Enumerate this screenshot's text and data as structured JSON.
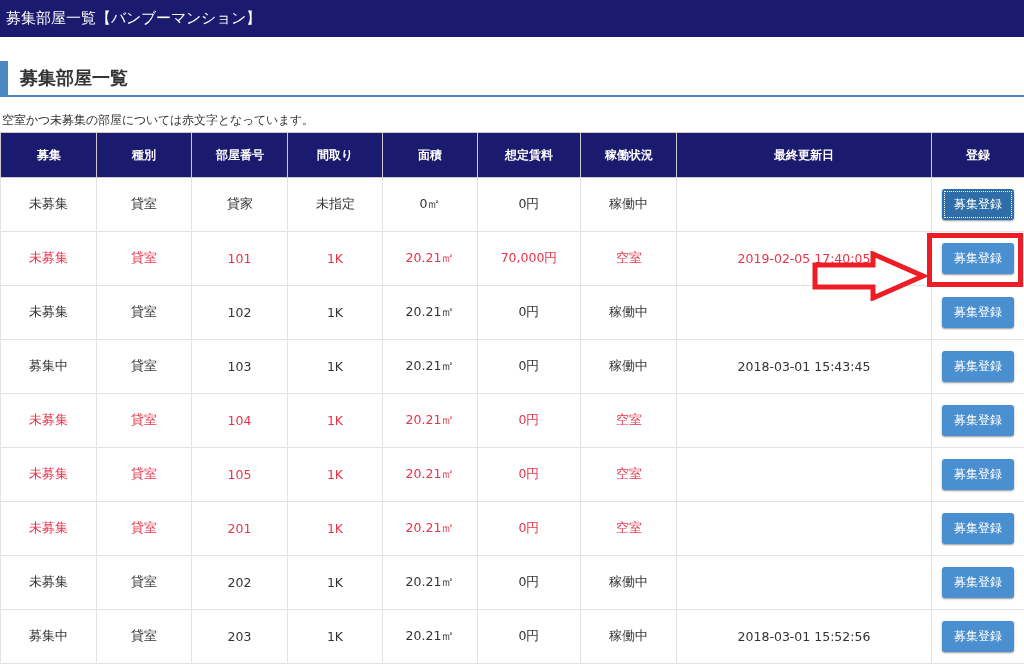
{
  "header": {
    "title": "募集部屋一覧【バンブーマンション】"
  },
  "section": {
    "heading": "募集部屋一覧",
    "note": "空室かつ未募集の部屋については赤文字となっています。"
  },
  "table": {
    "columns": [
      "募集",
      "種別",
      "部屋番号",
      "間取り",
      "面積",
      "想定賃料",
      "稼働状況",
      "最終更新日",
      "登録"
    ],
    "rows": [
      {
        "highlighted": false,
        "cells": [
          "未募集",
          "貸室",
          "貸家",
          "未指定",
          "0㎡",
          "0円",
          "稼働中",
          ""
        ],
        "button": "募集登録",
        "focused": true,
        "annotated": false
      },
      {
        "highlighted": true,
        "cells": [
          "未募集",
          "貸室",
          "101",
          "1K",
          "20.21㎡",
          "70,000円",
          "空室",
          "2019-02-05 17:40:05"
        ],
        "button": "募集登録",
        "focused": false,
        "annotated": true
      },
      {
        "highlighted": false,
        "cells": [
          "未募集",
          "貸室",
          "102",
          "1K",
          "20.21㎡",
          "0円",
          "稼働中",
          ""
        ],
        "button": "募集登録",
        "focused": false,
        "annotated": false
      },
      {
        "highlighted": false,
        "cells": [
          "募集中",
          "貸室",
          "103",
          "1K",
          "20.21㎡",
          "0円",
          "稼働中",
          "2018-03-01 15:43:45"
        ],
        "button": "募集登録",
        "focused": false,
        "annotated": false
      },
      {
        "highlighted": true,
        "cells": [
          "未募集",
          "貸室",
          "104",
          "1K",
          "20.21㎡",
          "0円",
          "空室",
          ""
        ],
        "button": "募集登録",
        "focused": false,
        "annotated": false
      },
      {
        "highlighted": true,
        "cells": [
          "未募集",
          "貸室",
          "105",
          "1K",
          "20.21㎡",
          "0円",
          "空室",
          ""
        ],
        "button": "募集登録",
        "focused": false,
        "annotated": false
      },
      {
        "highlighted": true,
        "cells": [
          "未募集",
          "貸室",
          "201",
          "1K",
          "20.21㎡",
          "0円",
          "空室",
          ""
        ],
        "button": "募集登録",
        "focused": false,
        "annotated": false
      },
      {
        "highlighted": false,
        "cells": [
          "未募集",
          "貸室",
          "202",
          "1K",
          "20.21㎡",
          "0円",
          "稼働中",
          ""
        ],
        "button": "募集登録",
        "focused": false,
        "annotated": false
      },
      {
        "highlighted": false,
        "cells": [
          "募集中",
          "貸室",
          "203",
          "1K",
          "20.21㎡",
          "0円",
          "稼働中",
          "2018-03-01 15:52:56"
        ],
        "button": "募集登録",
        "focused": false,
        "annotated": false
      }
    ]
  }
}
